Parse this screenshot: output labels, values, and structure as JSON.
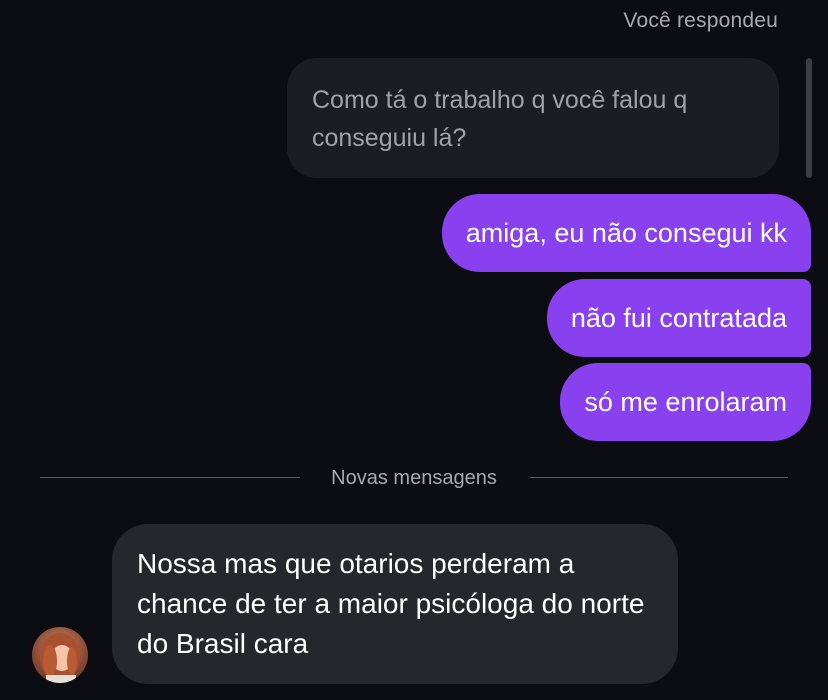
{
  "thread": {
    "reply_label": "Você respondeu",
    "quoted_message": "Como tá o trabalho q você falou q conseguiu lá?",
    "sent_messages": [
      "amiga, eu não consegui kk",
      "não fui contratada",
      "só me enrolaram"
    ],
    "divider_label": "Novas mensagens",
    "received_message": "Nossa mas que otarios perderam a chance de ter a maior psicóloga do norte do Brasil cara"
  },
  "colors": {
    "background": "#0c0d12",
    "sent_bubble": "#8940ef",
    "received_bubble": "#26272c",
    "quoted_bubble": "#1c1d22"
  }
}
